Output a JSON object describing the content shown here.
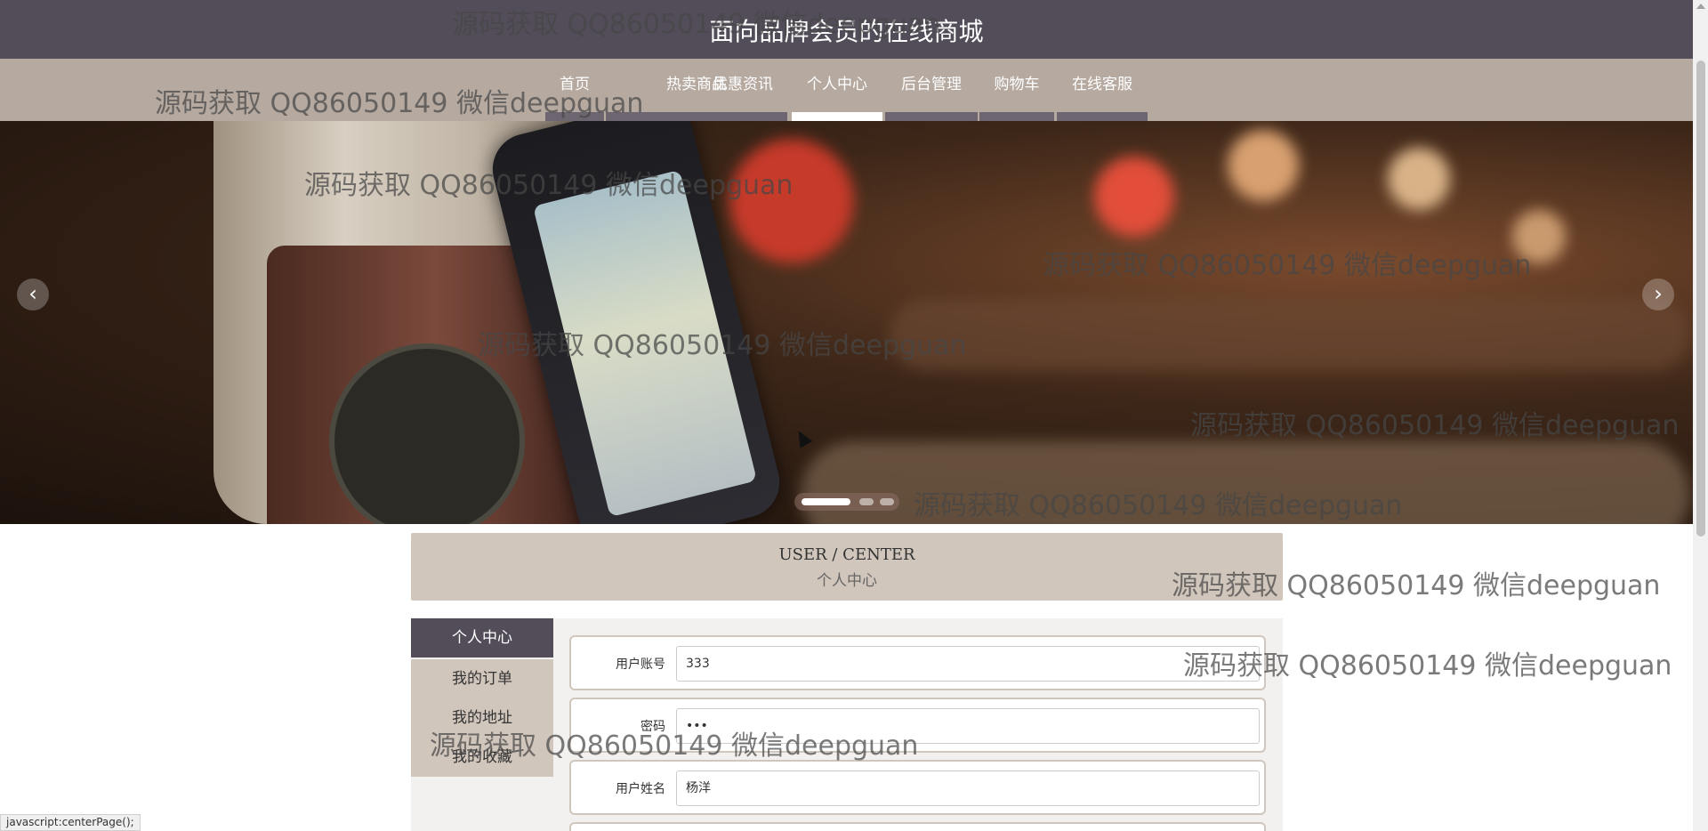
{
  "site": {
    "title": "面向品牌会员的在线商城"
  },
  "nav": {
    "items": [
      {
        "label": "首页"
      },
      {
        "label": "热卖商品"
      },
      {
        "label": "优惠资讯"
      },
      {
        "label": "个人中心",
        "active": true
      },
      {
        "label": "后台管理"
      },
      {
        "label": "购物车"
      },
      {
        "label": "在线客服"
      }
    ]
  },
  "banner": {
    "prev_icon": "chevron-left-icon",
    "next_icon": "chevron-right-icon",
    "prev_glyph": "‹",
    "next_glyph": "›",
    "slide_count": 3,
    "active_slide": 1
  },
  "center": {
    "heading_en": "USER / CENTER",
    "heading_cn": "个人中心"
  },
  "sidebar": {
    "items": [
      {
        "label": "个人中心",
        "active": true
      },
      {
        "label": "我的订单"
      },
      {
        "label": "我的地址"
      },
      {
        "label": "我的收藏"
      }
    ]
  },
  "form": {
    "fields": [
      {
        "label": "用户账号",
        "value": "333"
      },
      {
        "label": "密码",
        "value": "•••"
      },
      {
        "label": "用户姓名",
        "value": "杨洋"
      }
    ]
  },
  "watermark": {
    "text": "源码获取 QQ86050149 微信deepguan"
  },
  "status": {
    "text": "javascript:centerPage();"
  },
  "colors": {
    "topbar": "#534d59",
    "navbar": "#b5a9a0",
    "panel": "#d1c6bc",
    "active": "#534d59"
  }
}
